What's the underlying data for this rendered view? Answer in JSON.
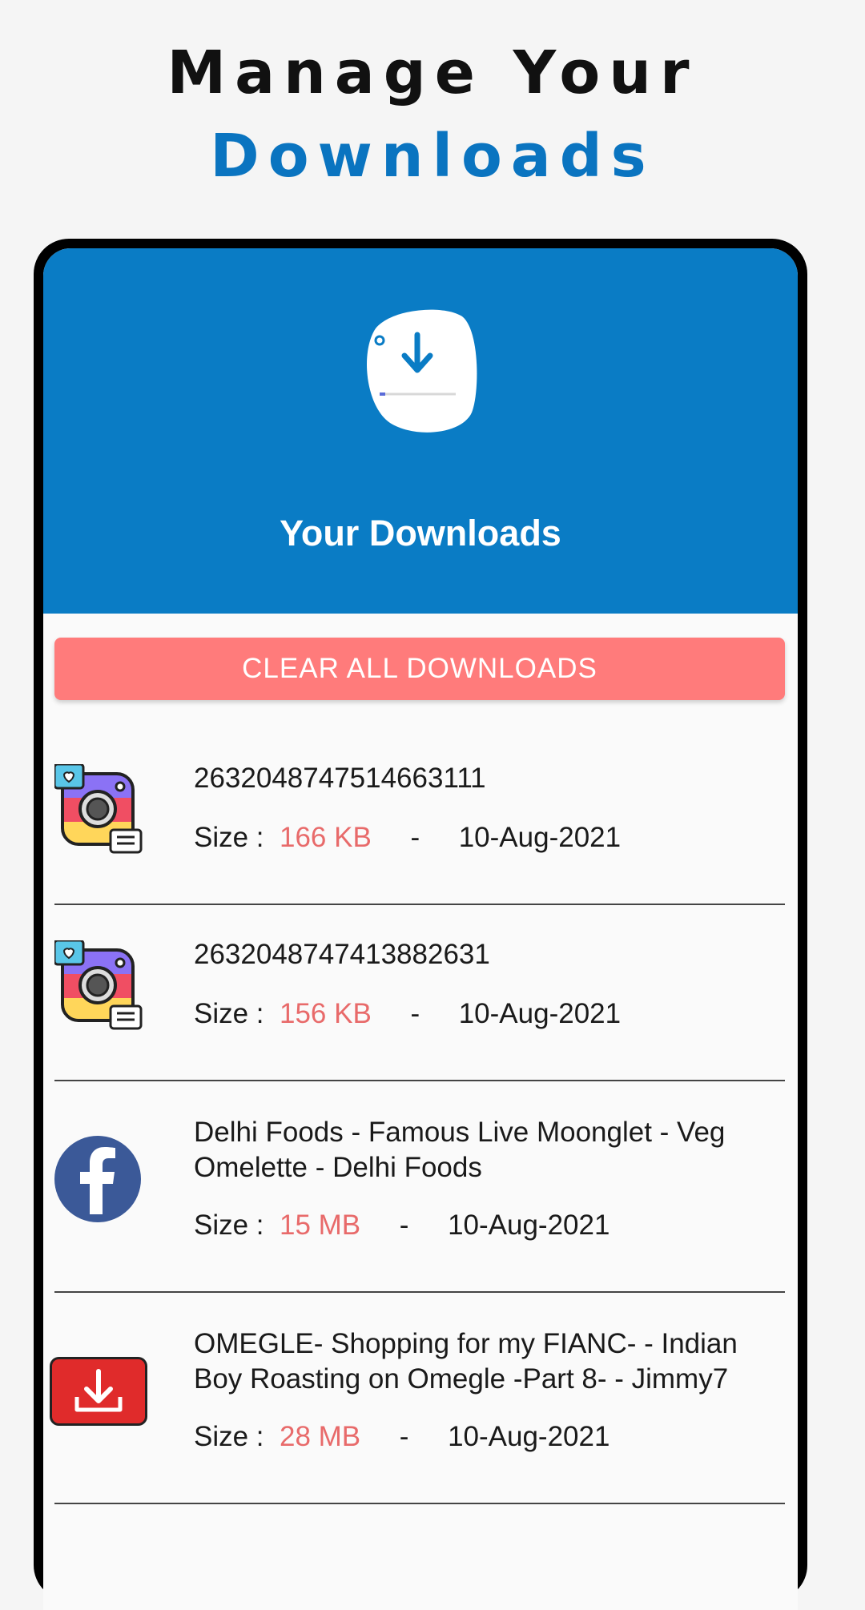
{
  "promo": {
    "line1": "Manage Your",
    "line2": "Downloads"
  },
  "header": {
    "title": "Your Downloads",
    "icon": "download-blob-icon"
  },
  "actions": {
    "clear_all": "CLEAR ALL DOWNLOADS"
  },
  "labels": {
    "size_prefix": "Size :",
    "separator": "-"
  },
  "downloads": [
    {
      "title": "2632048747514663111",
      "size": "166 KB",
      "date": "10-Aug-2021",
      "icon": "instagram-icon"
    },
    {
      "title": "2632048747413882631",
      "size": "156 KB",
      "date": "10-Aug-2021",
      "icon": "instagram-icon"
    },
    {
      "title": "Delhi Foods - Famous Live Moonglet - Veg Omelette - Delhi Foods",
      "size": "15 MB",
      "date": "10-Aug-2021",
      "icon": "facebook-icon"
    },
    {
      "title": "OMEGLE- Shopping for my FIANC- - Indian Boy Roasting on Omegle -Part 8- - Jimmy7",
      "size": "28 MB",
      "date": "10-Aug-2021",
      "icon": "video-downloader-icon"
    }
  ],
  "colors": {
    "accent": "#0a7cc5",
    "clear_button": "#ff7b7b",
    "size_text": "#e86a6a"
  }
}
